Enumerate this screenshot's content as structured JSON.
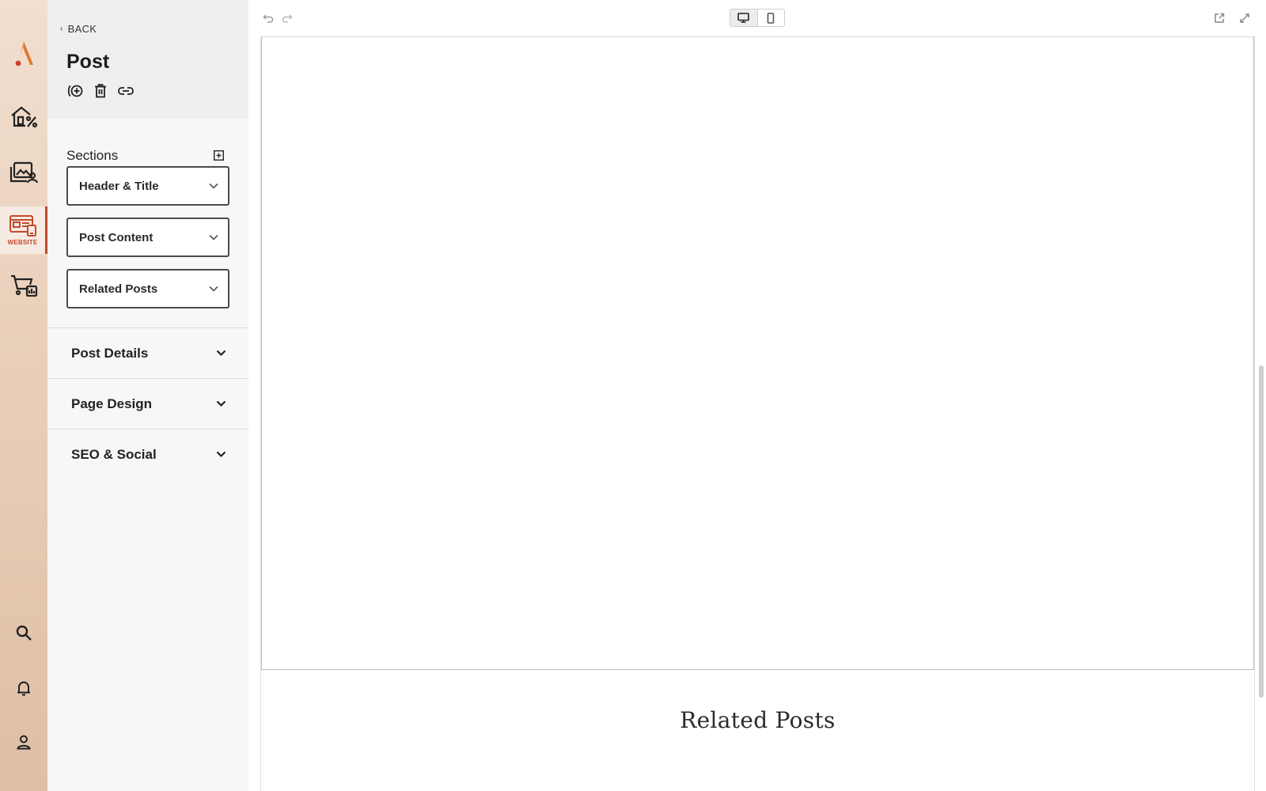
{
  "rail": {
    "items": [
      {
        "name": "logo",
        "icon": "brand-logo-icon"
      },
      {
        "name": "home",
        "icon": "home-percent-icon"
      },
      {
        "name": "media",
        "icon": "gallery-user-icon"
      },
      {
        "name": "website",
        "icon": "website-icon",
        "caption": "WEBSITE",
        "active": true
      },
      {
        "name": "store",
        "icon": "cart-chart-icon"
      },
      {
        "name": "search",
        "icon": "search-icon"
      },
      {
        "name": "notifications",
        "icon": "bell-icon"
      },
      {
        "name": "account",
        "icon": "user-icon"
      }
    ],
    "accent": "#c24a2c"
  },
  "panel": {
    "back_label": "BACK",
    "title": "Post",
    "tools": [
      "duplicate-icon",
      "trash-icon",
      "link-icon"
    ],
    "sections_label": "Sections",
    "sections": [
      {
        "label": "Header & Title"
      },
      {
        "label": "Post Content"
      },
      {
        "label": "Related Posts"
      }
    ],
    "accordions": [
      {
        "label": "Post Details"
      },
      {
        "label": "Page Design"
      },
      {
        "label": "SEO & Social"
      }
    ]
  },
  "toolbar": {
    "undo": "undo-icon",
    "redo": "redo-icon",
    "devices": [
      "desktop-icon",
      "mobile-icon"
    ],
    "active_device": "desktop",
    "open_external": "external-link-icon",
    "fullscreen": "expand-icon"
  },
  "preview": {
    "related_title": "Related Posts"
  }
}
